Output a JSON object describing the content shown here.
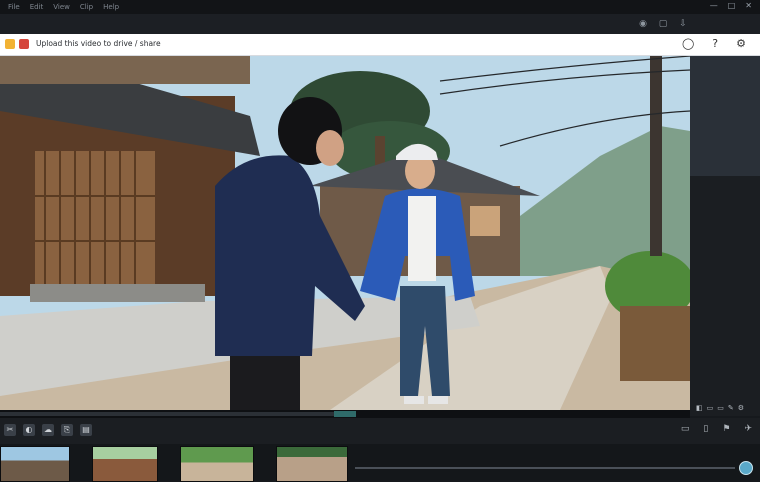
{
  "menu": {
    "items": [
      "File",
      "Edit",
      "View",
      "Clip",
      "Help"
    ]
  },
  "window": {
    "min_label": "—",
    "max_label": "□",
    "close_label": "✕"
  },
  "urlbar": {
    "text": "Upload this video to drive / share",
    "refresh_label": "◯",
    "help_label": "?",
    "settings_label": "⚙"
  },
  "scene": {
    "shirt_color": "#f2f2f0"
  },
  "player": {
    "progress_fraction": 0.5,
    "icons": [
      "◧",
      "▭",
      "▭",
      "✎",
      "⚙"
    ]
  },
  "timeline": {
    "left_tools": [
      "✂",
      "◐",
      "☁",
      "⎘",
      "▤"
    ],
    "right_tools": [
      "▭",
      "▯",
      "⚑",
      "✈"
    ],
    "zoom_fraction": 1.0
  },
  "colors": {
    "accent": "#2f6b6a",
    "slider_knob": "#5aa9c9"
  }
}
